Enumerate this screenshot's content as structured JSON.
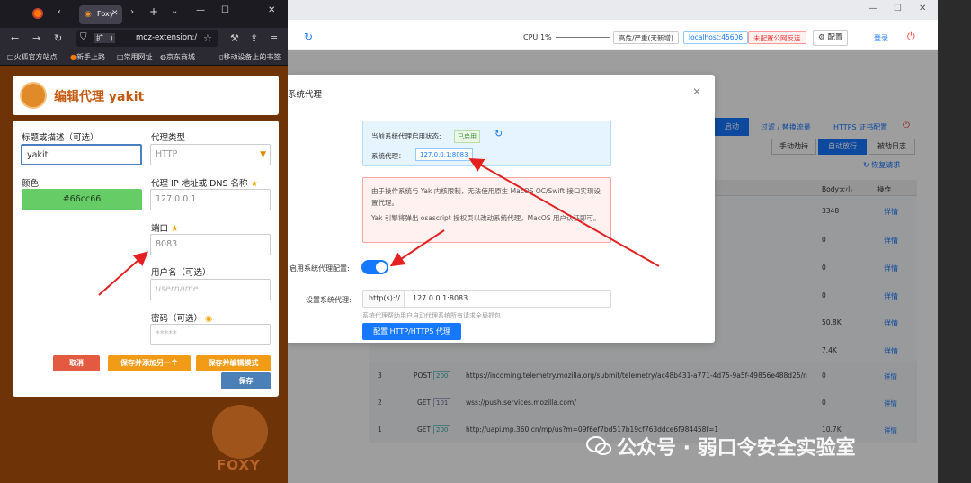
{
  "browser": {
    "tab_title": "Foxy",
    "url": "moz-extension:/",
    "url_prefix": "扩...)",
    "bookmarks": [
      "火狐官方站点",
      "新手上路",
      "常用网址",
      "京东商城",
      "移动设备上的书签"
    ]
  },
  "foxy": {
    "title": "编辑代理 yakit",
    "title_label": "标题或描述（可选）",
    "title_value": "yakit",
    "type_label": "代理类型",
    "type_value": "HTTP",
    "color_label": "颜色",
    "color_value": "#66cc66",
    "ip_label": "代理 IP 地址或 DNS 名称",
    "ip_value": "127.0.0.1",
    "port_label": "端口",
    "port_value": "8083",
    "user_label": "用户名（可选）",
    "user_placeholder": "username",
    "pass_label": "密码（可选）",
    "pass_placeholder": "*****",
    "cancel": "取消",
    "save_add": "保存并添加另一个",
    "save_edit": "保存并编辑模式",
    "save": "保存",
    "brand": "FOXY"
  },
  "yakit": {
    "cpu": "CPU:1%",
    "mode": "高危/严重(无新增)",
    "host": "localhost:45606",
    "proxy_warn": "未配置公网反连",
    "config": "配置",
    "login": "登录",
    "start": "启动",
    "filter": "过滤 / 替换流量",
    "https_cert": "HTTPS 证书配置",
    "manual": "手动劫持",
    "auto": "自动放行",
    "log": "被劫日志",
    "restore": "恢复请求",
    "col_body": "Body大小",
    "col_op": "操作",
    "detail": "详情"
  },
  "modal": {
    "title": "系统代理",
    "status_label": "当前系统代理启用状态:",
    "status_value": "已启用",
    "proxy_label": "系统代理：",
    "proxy_value": "127.0.0.1:8083",
    "warn1": "由于操作系统与 Yak 内核限制，无法使用原生 MacOS OC/Swift 接口实现设置代理。",
    "warn2": "Yak 引擎将弹出 osascript 授权页以改动系统代理，MacOS 用户认证即可。",
    "toggle_label": "启用系统代理配置:",
    "set_label": "设置系统代理:",
    "scheme": "http(s)://",
    "input_value": "127.0.0.1:8083",
    "help": "系统代理帮助用户自动代理系统所有请求全局抓包",
    "button": "配置 HTTP/HTTPS 代理"
  },
  "rows": [
    {
      "id": "3",
      "method": "POST",
      "code": "200",
      "url": "https://incoming.telemetry.mozilla.org/submit/telemetry/ac48b431-a771-4d75-9a5f-49856e488d25/new-profile/Fir",
      "size": "0"
    },
    {
      "id": "2",
      "method": "GET",
      "code": "101",
      "url": "wss://push.services.mozilla.com/",
      "size": "0"
    },
    {
      "id": "1",
      "method": "GET",
      "code": "200",
      "url": "http://uapi.mp.360.cn/mp/us?m=09f6ef7bd517b19cf763ddce6f984458f=1",
      "size": "10.7K"
    }
  ],
  "body_sizes": [
    "3348",
    "0",
    "0",
    "0",
    "50.8K",
    "7.4K"
  ],
  "watermark": "公众号 · 弱口令安全实验室"
}
